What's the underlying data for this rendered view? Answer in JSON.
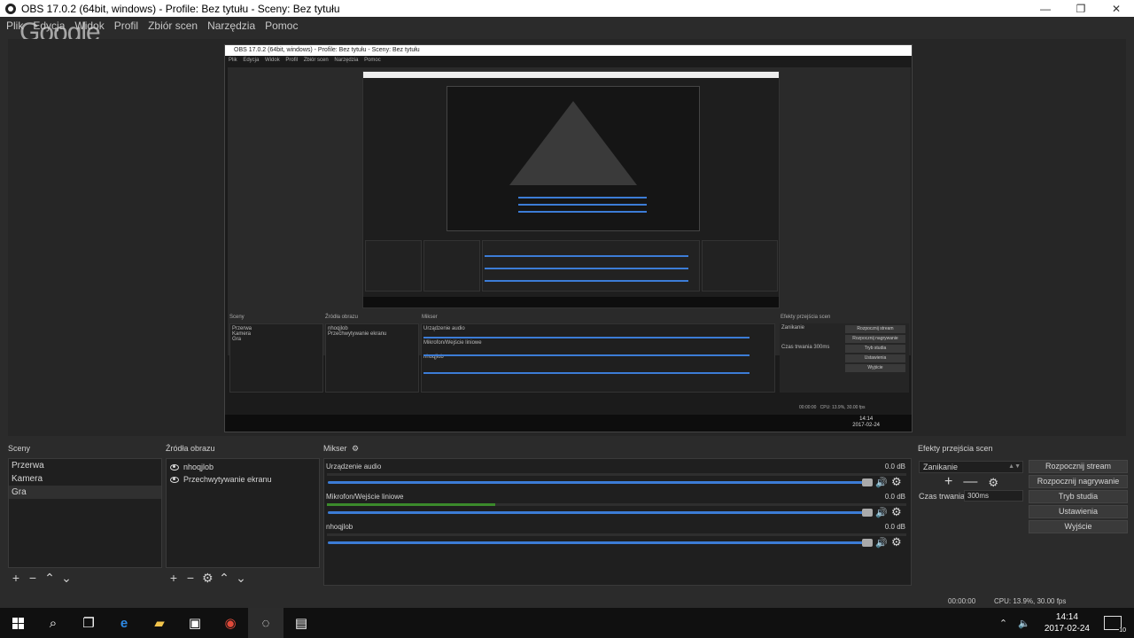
{
  "window": {
    "title": "OBS 17.0.2 (64bit, windows) - Profile: Bez tytułu - Sceny: Bez tytułu",
    "buttons": [
      "—",
      "❐",
      "✕"
    ]
  },
  "menu": [
    "Plik",
    "Edycja",
    "Widok",
    "Profil",
    "Zbiór scen",
    "Narzędzia",
    "Pomoc"
  ],
  "overlay": {
    "google_text": "Google"
  },
  "nested_preview": {
    "title": "OBS 17.0.2 (64bit, windows) - Profile: Bez tytułu - Sceny: Bez tytułu",
    "menu": [
      "Plik",
      "Edycja",
      "Widok",
      "Profil",
      "Zbiór scen",
      "Narzędzia",
      "Pomoc"
    ],
    "scenes_label": "Sceny",
    "scenes": [
      "Przerwa",
      "Kamera",
      "Gra"
    ],
    "sources_label": "Źródła obrazu",
    "sources": [
      "nhoqjlob",
      "Przechwytywanie ekranu"
    ],
    "mixer_label": "Mikser",
    "channels": [
      {
        "name": "Urządzenie audio",
        "db": "0.0 dB"
      },
      {
        "name": "Mikrofon/Wejście liniowe",
        "db": "0.0 dB"
      },
      {
        "name": "nhoqjlob",
        "db": "0.0 dB"
      }
    ],
    "transitions_label": "Efekty przejścia scen",
    "transition": "Zanikanie",
    "duration_label": "Czas trwania",
    "duration": "300ms",
    "buttons": [
      "Rozpocznij stream",
      "Rozpocznij nagrywanie",
      "Tryb studia",
      "Ustawienia",
      "Wyjście"
    ],
    "status_time": "00:00:00",
    "status_cpu": "CPU: 13.9%, 30.00 fps",
    "clock_time": "14:14",
    "clock_date": "2017-02-24"
  },
  "scenes": {
    "label": "Sceny",
    "items": [
      "Przerwa",
      "Kamera",
      "Gra"
    ],
    "selected_index": 2
  },
  "sources": {
    "label": "Źródła obrazu",
    "items": [
      "nhoqjlob",
      "Przechwytywanie ekranu"
    ]
  },
  "mixer": {
    "label": "Mikser",
    "channels": [
      {
        "name": "Urządzenie audio",
        "db": "0.0 dB",
        "level": 0.0
      },
      {
        "name": "Mikrofon/Wejście liniowe",
        "db": "0.0 dB",
        "level": 0.29
      },
      {
        "name": "nhoqjlob",
        "db": "0.0 dB",
        "level": 0.0
      }
    ],
    "volume_fraction": 0.93
  },
  "transitions": {
    "label": "Efekty przejścia scen",
    "selected": "Zanikanie",
    "duration_label": "Czas trwania",
    "duration": "300ms"
  },
  "controls": {
    "start_stream": "Rozpocznij stream",
    "start_recording": "Rozpocznij nagrywanie",
    "studio_mode": "Tryb studia",
    "settings": "Ustawienia",
    "exit": "Wyjście"
  },
  "status": {
    "time": "00:00:00",
    "cpu": "CPU: 13.9%, 30.00 fps"
  },
  "taskbar": {
    "clock_time": "14:14",
    "clock_date": "2017-02-24",
    "notification_count": "10",
    "apps": [
      "start-icon",
      "search-icon",
      "task-view-icon",
      "edge-icon",
      "file-explorer-icon",
      "store-icon",
      "chrome-icon",
      "obs-icon",
      "notepad-icon"
    ]
  },
  "colors": {
    "background": "#2b2b2b",
    "panel": "#1f1f1f",
    "volume_bar": "#3c7cd6",
    "meter_level": "#3b8a2b",
    "taskbar": "#101010"
  }
}
